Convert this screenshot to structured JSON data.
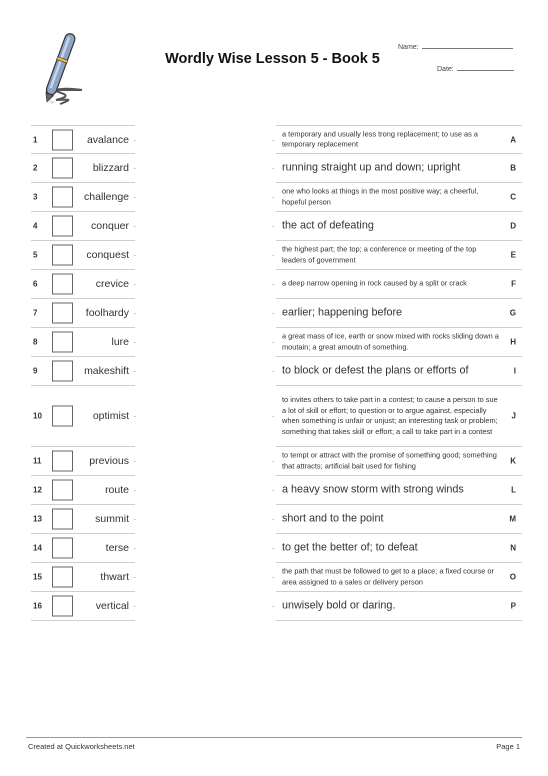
{
  "header": {
    "title": "Wordly Wise Lesson 5 - Book 5",
    "name_label": "Name:",
    "date_label": "Date:",
    "logo_icon": "pen-writing-icon"
  },
  "words": [
    {
      "num": "1",
      "word": "avalance"
    },
    {
      "num": "2",
      "word": "blizzard"
    },
    {
      "num": "3",
      "word": "challenge"
    },
    {
      "num": "4",
      "word": "conquer"
    },
    {
      "num": "5",
      "word": "conquest"
    },
    {
      "num": "6",
      "word": "crevice"
    },
    {
      "num": "7",
      "word": "foolhardy"
    },
    {
      "num": "8",
      "word": "lure"
    },
    {
      "num": "9",
      "word": "makeshift"
    },
    {
      "num": "10",
      "word": "optimist"
    },
    {
      "num": "11",
      "word": "previous"
    },
    {
      "num": "12",
      "word": "route"
    },
    {
      "num": "13",
      "word": "summit"
    },
    {
      "num": "14",
      "word": "terse"
    },
    {
      "num": "15",
      "word": "thwart"
    },
    {
      "num": "16",
      "word": "vertical"
    }
  ],
  "definitions": [
    {
      "letter": "A",
      "text": "a temporary and usually less trong replacement; to use as a temporary replacement",
      "size": "small"
    },
    {
      "letter": "B",
      "text": "running straight up and down; upright",
      "size": "large"
    },
    {
      "letter": "C",
      "text": "one who looks at things in the most positive way; a cheerful, hopeful person",
      "size": "small"
    },
    {
      "letter": "D",
      "text": "the act of defeating",
      "size": "large"
    },
    {
      "letter": "E",
      "text": "the highest part; the top; a conference or meeting of the top leaders of government",
      "size": "small"
    },
    {
      "letter": "F",
      "text": "a deep narrow opening in rock caused by a split or crack",
      "size": "small"
    },
    {
      "letter": "G",
      "text": "earlier; happening before",
      "size": "large"
    },
    {
      "letter": "H",
      "text": "a great mass of ice, earth or snow mixed with rocks sliding down a moutain; a great amoutn of something.",
      "size": "small"
    },
    {
      "letter": "I",
      "text": "to block or defest the plans or efforts of",
      "size": "large"
    },
    {
      "letter": "J",
      "text": "to invites others to take part in a contest; to cause a person to sue a lot of skill or effort; to question or to argue against, especially when something is unfair or unjust; an interesting task or problem; something that takes skill or effort; a call to take part in a contest",
      "size": "small"
    },
    {
      "letter": "K",
      "text": "to tempt or attract with the promise of something good; something that attracts; artificial bait used for fishing",
      "size": "small"
    },
    {
      "letter": "L",
      "text": "a heavy snow storm with strong winds",
      "size": "large"
    },
    {
      "letter": "M",
      "text": "short and to the point",
      "size": "large"
    },
    {
      "letter": "N",
      "text": "to get the better of; to defeat",
      "size": "large"
    },
    {
      "letter": "O",
      "text": "the path that must be followed to get to a place; a fixed course or area assigned to a sales or delivery person",
      "size": "small"
    },
    {
      "letter": "P",
      "text": "unwisely bold or daring.",
      "size": "large"
    }
  ],
  "footer": {
    "credit": "Created at Quickworksheets.net",
    "page": "Page 1"
  }
}
